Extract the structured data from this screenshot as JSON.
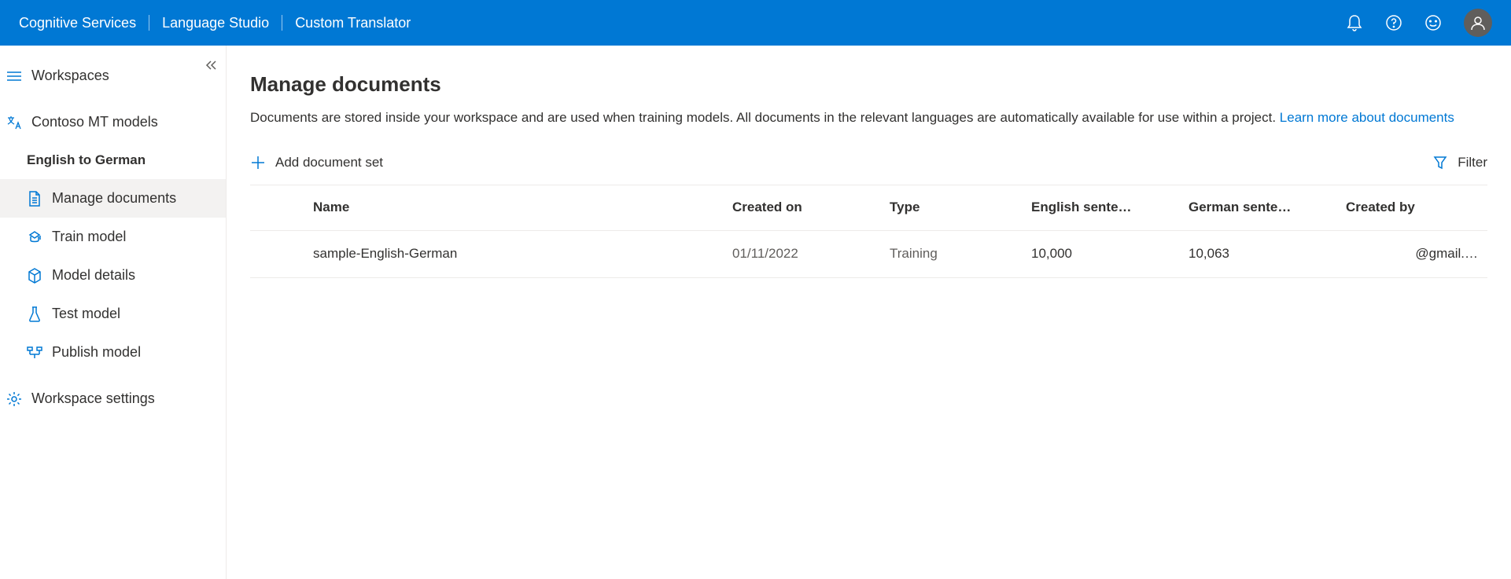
{
  "header": {
    "breadcrumbs": [
      "Cognitive Services",
      "Language Studio",
      "Custom Translator"
    ]
  },
  "sidebar": {
    "workspaces": "Workspaces",
    "workspace_name": "Contoso MT models",
    "project_name": "English to German",
    "items": {
      "manage_documents": "Manage documents",
      "train_model": "Train model",
      "model_details": "Model details",
      "test_model": "Test model",
      "publish_model": "Publish model"
    },
    "workspace_settings": "Workspace settings"
  },
  "main": {
    "title": "Manage documents",
    "description": "Documents are stored inside your workspace and are used when training models. All documents in the relevant languages are automatically available for use within a project. ",
    "learn_more": "Learn more about documents",
    "add_button": "Add document set",
    "filter_button": "Filter",
    "columns": {
      "name": "Name",
      "created_on": "Created on",
      "type": "Type",
      "english_sentences": "English sente…",
      "german_sentences": "German sente…",
      "created_by": "Created by"
    },
    "rows": [
      {
        "name": "sample-English-German",
        "created_on": "01/11/2022",
        "type": "Training",
        "english_sentences": "10,000",
        "german_sentences": "10,063",
        "created_by": "@gmail.…"
      }
    ]
  }
}
